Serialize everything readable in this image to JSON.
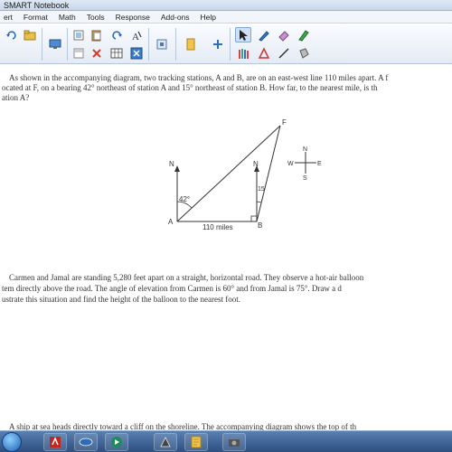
{
  "window": {
    "title": "SMART Notebook"
  },
  "menubar": {
    "items": [
      "ert",
      "Format",
      "Math",
      "Tools",
      "Response",
      "Add-ons",
      "Help"
    ]
  },
  "toolbar": {
    "icons": [
      "redo-icon",
      "open-folder-icon",
      "screen-capture-icon",
      "paste-icon",
      "cut-icon",
      "undo-icon",
      "delete-icon",
      "display-screen-icon",
      "table-icon",
      "text-recognition-icon",
      "fit-page-icon",
      "response-icon",
      "addon-icon",
      "select-arrow-icon",
      "pen-icon",
      "eraser-icon",
      "creative-pen-icon",
      "line-icon",
      "shape-icon",
      "pens-icon",
      "triangle-icon",
      "line-tool-icon",
      "fill-icon"
    ]
  },
  "question1": {
    "line1": "As shown in the accompanying diagram, two tracking stations, A and B, are on an east-west line 110 miles apart.  A f",
    "line2": "ocated at F, on a bearing 42° northeast of station A and 15° northeast of station B.  How far, to the nearest mile, is th",
    "line3": "ation A?"
  },
  "diagram": {
    "label_n_a": "N",
    "label_n_b": "N",
    "label_angle_a": "42°",
    "label_angle_b": "15",
    "label_a": "A",
    "label_b": "B",
    "label_f": "F",
    "label_distance": "110 miles",
    "compass_n": "N",
    "compass_s": "S",
    "compass_w": "W",
    "compass_e": "E"
  },
  "question2": {
    "line1": "Carmen and Jamal are standing 5,280 feet apart on a straight, horizontal road. They observe a hot-air balloon",
    "line2": "tem directly above the road.  The angle of elevation from Carmen is 60° and from Jamal is 75°.  Draw a d",
    "line3": "ustrate this situation and find the height of the balloon to the nearest foot."
  },
  "question3": {
    "line1": "A ship at sea heads directly toward a cliff on the shoreline.  The accompanying diagram shows the top of th"
  },
  "taskbar": {
    "apps": [
      "start-orb-icon",
      "pdf-reader-icon",
      "network-icon",
      "media-player-icon",
      "smart-board-icon",
      "notebook-icon",
      "camera-icon"
    ]
  }
}
